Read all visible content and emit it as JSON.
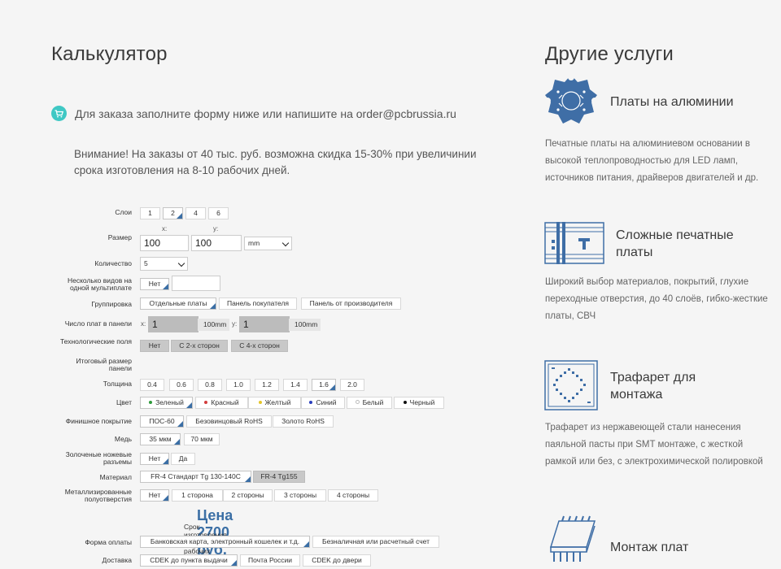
{
  "calc": {
    "title": "Калькулятор",
    "notice": "Для заказа заполните форму ниже или напишите на order@pcbrussia.ru",
    "warning": "Внимание! На заказы от 40 тыс. руб. возможна скидка 15-30% при увеличинии срока изготовления на 8-10 рабочих дней.",
    "layers": {
      "label": "Слои",
      "options": [
        "1",
        "2",
        "4",
        "6"
      ]
    },
    "size": {
      "label": "Размер",
      "x_label": "x:",
      "y_label": "y:",
      "x_value": "100",
      "y_value": "100",
      "unit": "mm"
    },
    "qty": {
      "label": "Количество",
      "value": "5"
    },
    "multi": {
      "label": "Несколько видов на одной мультиплате",
      "value": "Нет"
    },
    "grouping": {
      "label": "Группировка",
      "options": [
        "Отдельные платы",
        "Панель покупателя",
        "Панель от производителя"
      ]
    },
    "panel_count": {
      "label": "Число плат в панели",
      "x_label": "x:",
      "y_label": "y:",
      "x_value": "1",
      "y_value": "1",
      "x_suffix": "100mm",
      "y_suffix": "100mm"
    },
    "tech_fields": {
      "label": "Технологические поля",
      "options": [
        "Нет",
        "С 2-х сторон",
        "С 4-х сторон"
      ]
    },
    "panel_size": {
      "label": "Итоговый размер панели"
    },
    "thickness": {
      "label": "Толщина",
      "options": [
        "0.4",
        "0.6",
        "0.8",
        "1.0",
        "1.2",
        "1.4",
        "1.6",
        "2.0"
      ]
    },
    "color": {
      "label": "Цвет",
      "options": [
        "Зеленый",
        "Красный",
        "Желтый",
        "Синий",
        "Белый",
        "Черный"
      ],
      "dots": [
        "#2e9a3a",
        "#d23c3c",
        "#e3c52a",
        "#2a3fbd",
        "#ffffff",
        "#111111"
      ]
    },
    "finish": {
      "label": "Финишное покрытие",
      "options": [
        "ПОС-60",
        "Безовинцовый RoHS",
        "Золото RoHS"
      ]
    },
    "copper": {
      "label": "Медь",
      "options": [
        "35 мкм",
        "70 мкм"
      ]
    },
    "gold_fingers": {
      "label": "Золоченые ножевые разъемы",
      "options": [
        "Нет",
        "Да"
      ]
    },
    "material": {
      "label": "Материал",
      "options": [
        "FR-4 Стандарт Tg 130-140C",
        "FR-4 Tg155"
      ]
    },
    "plated_half": {
      "label": "Металлизированные полуотверстия",
      "options": [
        "Нет",
        "1 сторона",
        "2 стороны",
        "3 стороны",
        "4 стороны"
      ]
    },
    "price": "Цена 2700 руб.",
    "term": "Срок изготовления 20-31 рабочих дней",
    "payment": {
      "label": "Форма оплаты",
      "options": [
        "Банковская карта, электронный кошелек и т.д.",
        "Безналичная или расчетный счет"
      ]
    },
    "delivery": {
      "label": "Доставка",
      "options": [
        "CDEK до пункта выдачи",
        "Почта России",
        "CDEK до двери"
      ]
    }
  },
  "services": {
    "title": "Другие услуги",
    "items": [
      {
        "title": "Платы на алюминии",
        "desc": "Печатные платы на алюминиевом основании в высокой теплопроводностью для LED ламп, источников питания, драйверов двигателей и др.",
        "icon": "aluminum-pcb-icon"
      },
      {
        "title": "Сложные печатные платы",
        "desc": "Широкий выбор материалов, покрытий, глухие переходные отверстия, до 40 слоёв, гибко-жесткие платы, СВЧ",
        "icon": "complex-pcb-icon"
      },
      {
        "title": "Трафарет для монтажа",
        "desc": "Трафарет из нержавеющей стали нанесения паяльной пасты при SMT монтаже, с жесткой рамкой или без, с электрохимической полировкой",
        "icon": "stencil-icon"
      },
      {
        "title": "Монтаж плат",
        "desc": "",
        "icon": "chip-icon"
      }
    ]
  },
  "colors": {
    "accent": "#3b6fa5",
    "cart": "#3fc8c4"
  }
}
